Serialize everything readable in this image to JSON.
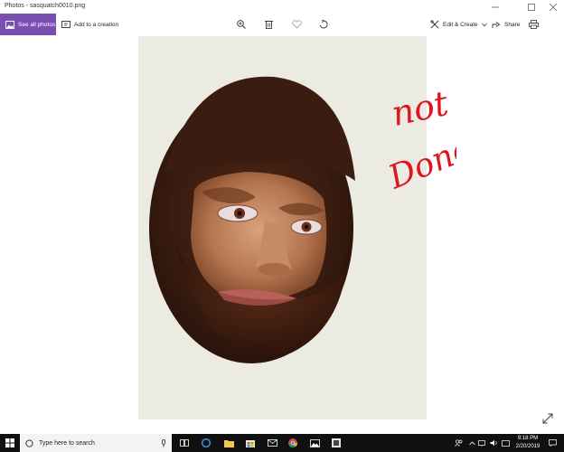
{
  "window": {
    "title": "Photos - sasquatch0010.png"
  },
  "toolbar": {
    "see_all_label": "See all photos",
    "add_label": "Add to a creation",
    "edit_label": "Edit & Create",
    "share_label": "Share"
  },
  "canvas": {
    "annotation_line1": "not",
    "annotation_line2": "Done",
    "annotation_color": "#e0141e"
  },
  "taskbar": {
    "search_placeholder": "Type here to search",
    "time": "9:18 PM",
    "date": "2/20/2019"
  },
  "colors": {
    "accent": "#7b4fb1",
    "taskbar": "#101010"
  },
  "icons": [
    "windows-logo-icon",
    "search-icon",
    "mic-icon",
    "task-view-icon",
    "edge-icon",
    "file-explorer-icon",
    "store-icon",
    "mail-icon",
    "chrome-icon",
    "photos-icon",
    "app-icon",
    "zoom-icon",
    "delete-icon",
    "heart-icon",
    "rotate-icon",
    "edit-icon",
    "share-icon",
    "print-icon",
    "expand-icon",
    "people-icon",
    "wifi-icon",
    "volume-icon",
    "notification-icon"
  ]
}
